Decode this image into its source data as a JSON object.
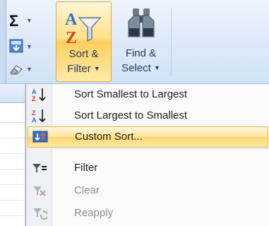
{
  "ribbon": {
    "sort_filter": {
      "line1": "Sort &",
      "line2": "Filter",
      "icon": "sort-filter-icon"
    },
    "find_select": {
      "line1": "Find &",
      "line2": "Select",
      "icon": "binoculars-icon"
    },
    "left_tools": [
      "autosum-icon",
      "fill-icon",
      "clear-icon"
    ]
  },
  "menu": {
    "items": [
      {
        "label": "Sort Smallest to Largest",
        "icon": "sort-ascending-icon",
        "enabled": true
      },
      {
        "label": "Sort Largest to Smallest",
        "icon": "sort-descending-icon",
        "enabled": true
      },
      {
        "label": "Custom Sort...",
        "icon": "custom-sort-icon",
        "enabled": true,
        "highlighted": true
      },
      {
        "label": "Filter",
        "icon": "filter-icon",
        "enabled": true
      },
      {
        "label": "Clear",
        "icon": "clear-filter-icon",
        "enabled": false
      },
      {
        "label": "Reapply",
        "icon": "reapply-filter-icon",
        "enabled": false
      }
    ]
  },
  "colors": {
    "highlight": "#ffe49a",
    "ribbon": "#dde9f8",
    "text": "#1e395b"
  }
}
